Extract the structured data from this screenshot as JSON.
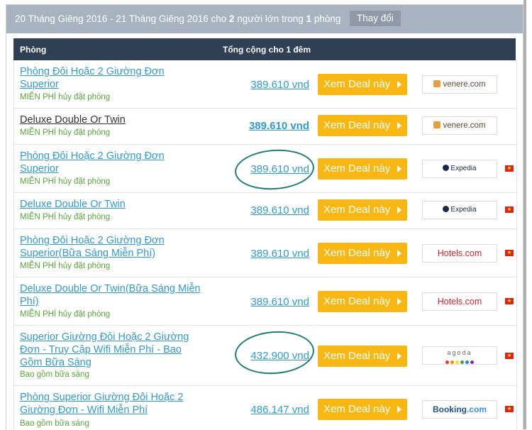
{
  "search_bar": {
    "dates_prefix": "20 Tháng Giêng 2016 - 21 Tháng Giêng 2016 cho ",
    "adults_count": "2",
    "adults_mid": " người lớn trong ",
    "rooms_count": "1",
    "rooms_suffix": " phòng",
    "change_label": "Thay đổi"
  },
  "table_header": {
    "room": "Phòng",
    "total": "Tổng cộng cho 1 đêm"
  },
  "deal_button_label": "Xem Deal này",
  "rows": [
    {
      "room": "Phòng Đôi Hoặc 2 Giường Đơn Superior",
      "sub": "MIỄN PHÍ hủy đặt phòng",
      "price": "389.610 vnd",
      "provider": "venere.com"
    },
    {
      "room": "Deluxe Double Or Twin",
      "sub": "MIỄN PHÍ hủy đặt phòng",
      "price": "389.610 vnd",
      "provider": "venere.com"
    },
    {
      "room": "Phòng Đôi Hoặc 2 Giường Đơn Superior",
      "sub": "MIỄN PHÍ hủy đặt phòng",
      "price": "389.610 vnd",
      "provider": "Expedia"
    },
    {
      "room": "Deluxe Double Or Twin",
      "sub": "MIỄN PHÍ hủy đặt phòng",
      "price": "389.610 vnd",
      "provider": "Expedia"
    },
    {
      "room": "Phòng Đôi Hoặc 2 Giường Đơn Superior(Bữa Sáng Miễn Phí)",
      "sub": "MIỄN PHÍ hủy đặt phòng",
      "price": "389.610 vnd",
      "provider": "Hotels.com"
    },
    {
      "room": "Deluxe Double Or Twin(Bữa Sáng Miễn Phí)",
      "sub": "MIỄN PHÍ hủy đặt phòng",
      "price": "389.610 vnd",
      "provider": "Hotels.com"
    },
    {
      "room": "Superior Giường Đôi Hoặc 2 Giường Đơn - Truy Cập Wifi Miễn Phí - Bao Gồm Bữa Sáng",
      "sub": "Bao gồm bữa sáng",
      "price": "432.900 vnd",
      "provider": "agoda"
    },
    {
      "room": "Phòng Superior Giường Đôi Hoặc 2 Giường Đơn - Wifi Miễn Phí",
      "sub": "Bao gồm bữa sáng",
      "price": "486.147 vnd",
      "provider": "Booking",
      "provider_suffix": ".com"
    }
  ],
  "colors": {
    "accent_yellow": "#f8b712",
    "link_blue": "#2e9ad6",
    "header_navy": "#2f3f54",
    "annotation_teal": "#1f7d73"
  }
}
